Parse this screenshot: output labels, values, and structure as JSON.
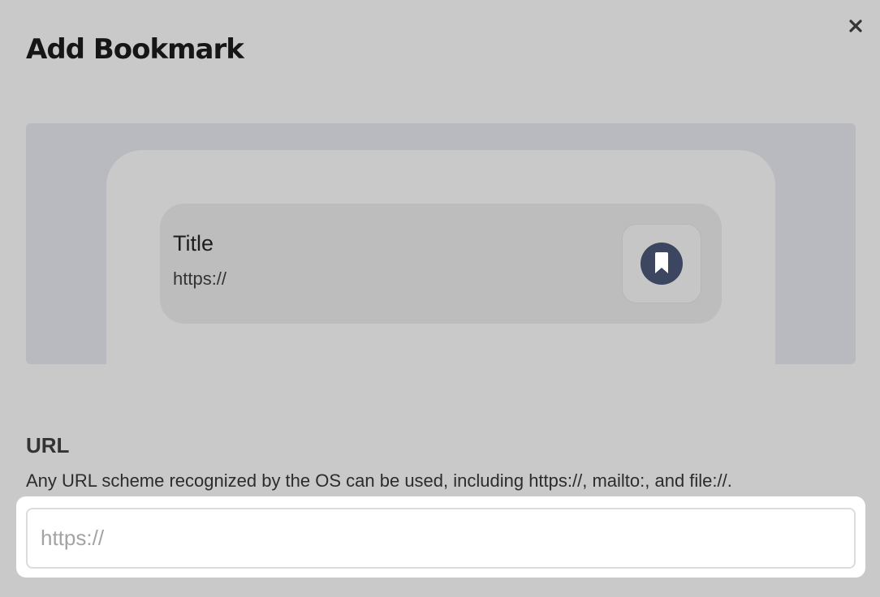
{
  "dialog": {
    "title": "Add Bookmark",
    "close_icon": "close-icon"
  },
  "preview": {
    "card_title": "Title",
    "card_url": "https://",
    "icon": "bookmark-icon",
    "icon_color": "#3c4660"
  },
  "url_field": {
    "label": "URL",
    "description": "Any URL scheme recognized by the OS can be used, including https://, mailto:, and file://.",
    "value": "",
    "placeholder": "https://"
  }
}
